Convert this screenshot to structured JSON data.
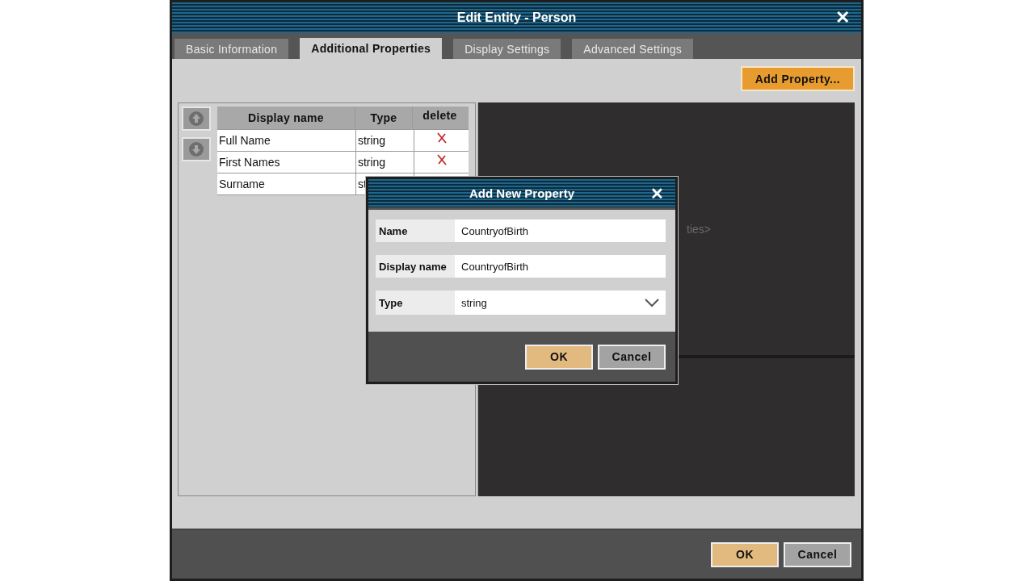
{
  "window": {
    "title": "Edit Entity - Person",
    "close": "✕"
  },
  "tabs": [
    {
      "label": "Basic Information",
      "selected": false
    },
    {
      "label": "Additional Properties",
      "selected": true
    },
    {
      "label": "Display Settings",
      "selected": false
    },
    {
      "label": "Advanced Settings",
      "selected": false
    }
  ],
  "add_button": "Add Property...",
  "table": {
    "columns": [
      "Display name",
      "Type",
      "delete"
    ],
    "rows": [
      {
        "display_name": "Full Name",
        "type": "string"
      },
      {
        "display_name": "First Names",
        "type": "string"
      },
      {
        "display_name": "Surname",
        "type": "st"
      }
    ]
  },
  "details_placeholder": "ties>",
  "dialog": {
    "title": "Add New Property",
    "close": "✕",
    "fields": [
      {
        "label": "Name",
        "value": "CountryofBirth",
        "kind": "text"
      },
      {
        "label": "Display name",
        "value": "CountryofBirth",
        "kind": "text"
      },
      {
        "label": "Type",
        "value": "string",
        "kind": "dropdown"
      }
    ],
    "buttons": [
      {
        "label": "OK",
        "kind": "primary"
      },
      {
        "label": "Cancel",
        "kind": "secondary"
      }
    ]
  },
  "buttons": [
    {
      "label": "OK",
      "kind": "primary"
    },
    {
      "label": "Cancel",
      "kind": "secondary"
    }
  ]
}
